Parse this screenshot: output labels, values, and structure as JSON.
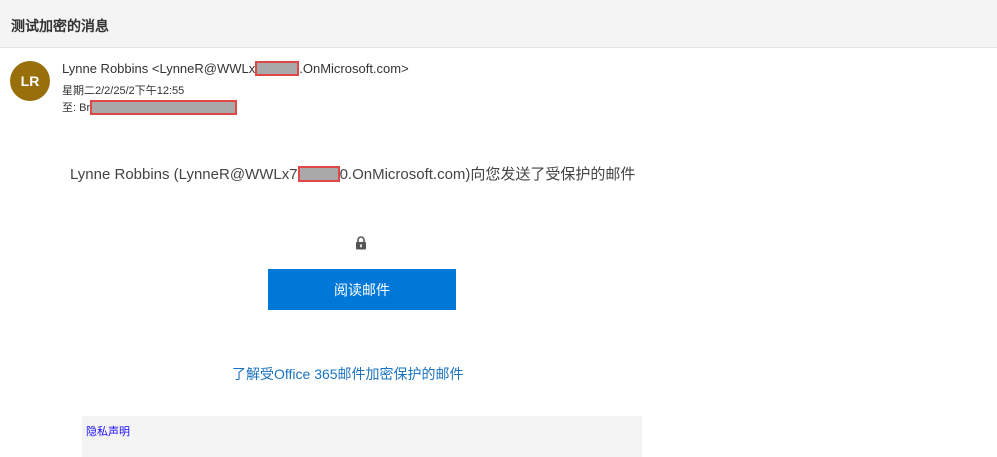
{
  "subject": "测试加密的消息",
  "sender": {
    "initials": "LR",
    "avatar_color": "#986f0b",
    "from_prefix": "Lynne Robbins <LynneR@WWLx",
    "from_suffix": ".OnMicrosoft.com>",
    "date": "星期二2/2/25/2下午12:55",
    "to_label": "至: Br"
  },
  "body": {
    "sent_prefix": "Lynne Robbins (LynneR@WWLx7",
    "sent_suffix": "0.OnMicrosoft.com)向您发送了受保护的邮件",
    "lock_icon": "lock-icon",
    "read_button_label": "阅读邮件",
    "read_button_color": "#0078d7",
    "learn_more_link": "了解受Office 365邮件加密保护的邮件",
    "privacy_link": "隐私声明"
  }
}
